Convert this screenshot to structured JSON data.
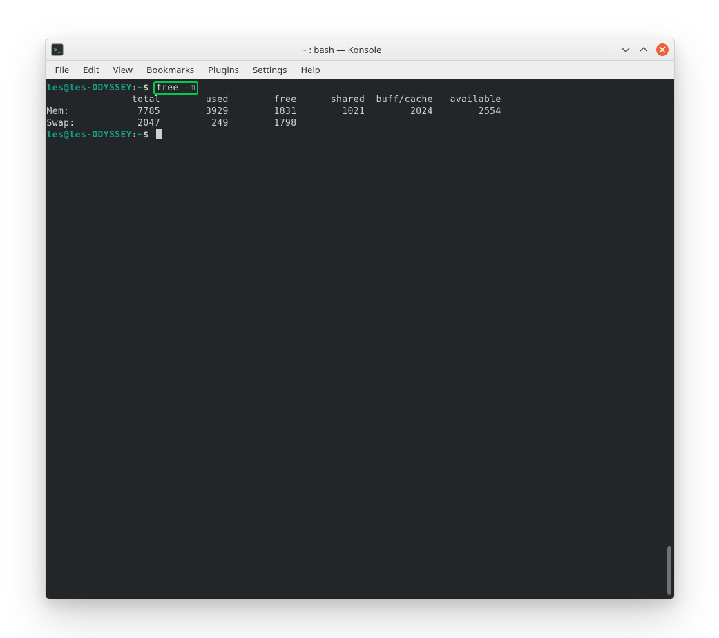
{
  "window": {
    "title": "~ : bash — Konsole"
  },
  "menu": {
    "items": [
      "File",
      "Edit",
      "View",
      "Bookmarks",
      "Plugins",
      "Settings",
      "Help"
    ]
  },
  "terminal": {
    "prompt_user_host": "les@les-ODYSSEY",
    "prompt_sep1": ":",
    "prompt_path": "~",
    "prompt_symbol": "$",
    "command": "free -m",
    "headers": [
      "total",
      "used",
      "free",
      "shared",
      "buff/cache",
      "available"
    ],
    "rows": [
      {
        "label": "Mem:",
        "total": "7785",
        "used": "3929",
        "free": "1831",
        "shared": "1021",
        "buffcache": "2024",
        "available": "2554"
      },
      {
        "label": "Swap:",
        "total": "2047",
        "used": "249",
        "free": "1798",
        "shared": "",
        "buffcache": "",
        "available": ""
      }
    ]
  },
  "colors": {
    "prompt": "#16a085",
    "highlight": "#00c853",
    "term_bg": "#232629",
    "term_fg": "#d0d0d0",
    "close_btn": "#e9643a"
  }
}
